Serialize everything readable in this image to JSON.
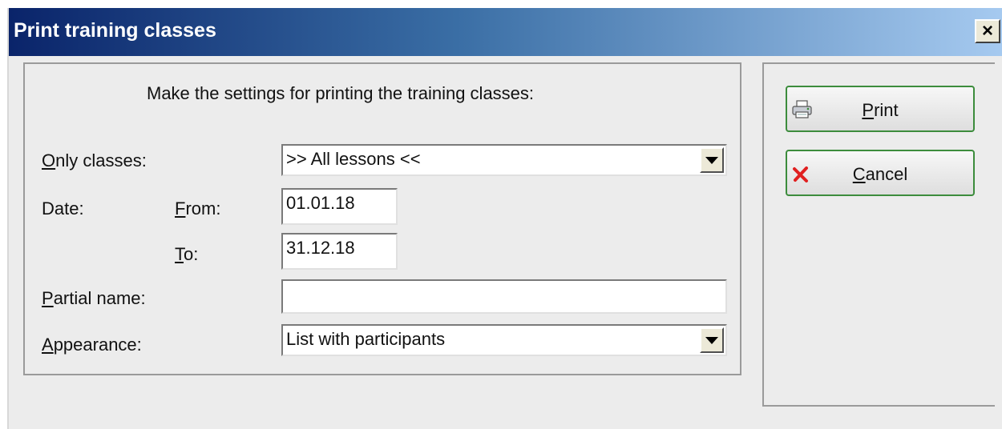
{
  "window": {
    "title": "Print training classes",
    "close_label": "×"
  },
  "form": {
    "header": "Make the settings for printing the training classes:",
    "only_classes": {
      "label_mnemonic": "O",
      "label_rest": "nly classes:",
      "value": ">> All lessons <<"
    },
    "date": {
      "label": "Date:",
      "from_mnemonic": "F",
      "from_rest": "rom:",
      "from_value": "01.01.18",
      "to_mnemonic": "T",
      "to_rest": "o:",
      "to_value": "31.12.18"
    },
    "partial_name": {
      "label_mnemonic": "P",
      "label_rest": "artial name:",
      "value": ""
    },
    "appearance": {
      "label_mnemonic": "A",
      "label_rest": "ppearance:",
      "value": "List with participants"
    }
  },
  "buttons": {
    "print": {
      "mnemonic": "P",
      "rest": "rint",
      "icon": "printer-icon"
    },
    "cancel": {
      "mnemonic": "C",
      "rest": "ancel",
      "icon": "cancel-x-icon"
    }
  },
  "colors": {
    "title_gradient_start": "#0a246a",
    "title_gradient_end": "#a6caf0",
    "button_border": "#3c8c3c",
    "cancel_icon": "#e02020"
  }
}
